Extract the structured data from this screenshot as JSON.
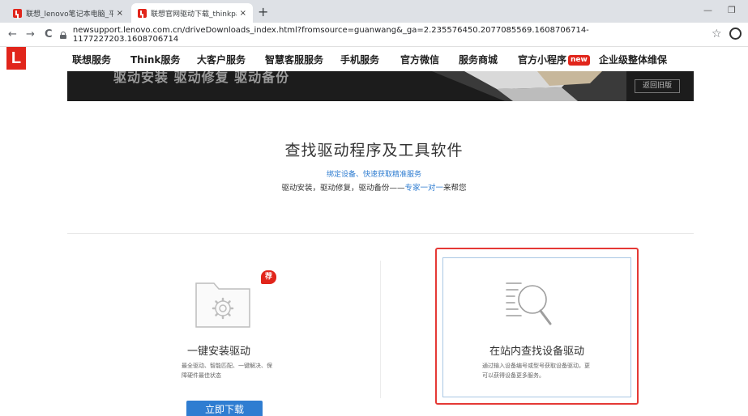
{
  "browser": {
    "tabs": [
      {
        "title": "联想_lenovo笔记本电脑_平板电脑",
        "close": "×"
      },
      {
        "title": "联想官网驱动下载_thinkpad驱动",
        "close": "×"
      }
    ],
    "new_tab": "+",
    "window_minimize": "—",
    "window_restore": "❐",
    "nav": {
      "back": "←",
      "forward": "→",
      "reload": "C"
    },
    "url": "newsupport.lenovo.com.cn/driveDownloads_index.html?fromsource=guanwang&_ga=2.235576450.2077085569.1608706714-1177227203.1608706714",
    "star": "☆"
  },
  "site": {
    "logo": "L",
    "nav_items": [
      {
        "label": "联想服务"
      },
      {
        "label": "Think服务"
      },
      {
        "label": "大客户服务"
      },
      {
        "label": "智慧客服服务"
      },
      {
        "label": "手机服务"
      },
      {
        "label": "官方微信"
      },
      {
        "label": "服务商城"
      },
      {
        "label": "官方小程序"
      },
      {
        "label": "企业级整体维保"
      }
    ],
    "new_badge": "new"
  },
  "banner": {
    "text": "驱动安装  驱动修复  驱动备份",
    "button": "返回旧版"
  },
  "hero": {
    "title": "查找驱动程序及工具软件",
    "subtitle_link": "绑定设备、快速获取精准服务",
    "subtitle_prefix": "驱动安装，驱动修复，驱动备份——",
    "subtitle_highlight": "专家一对一",
    "subtitle_suffix": "来帮您"
  },
  "left_card": {
    "badge": "荐",
    "title": "一键安装驱动",
    "description": "最全驱动、智能匹配、一键解决、保障硬件最佳状态",
    "button": "立即下载"
  },
  "right_card": {
    "title": "在站内查找设备驱动",
    "description": "通过输入设备编号或型号获取设备驱动，更可以获得设备更多服务。"
  },
  "colors": {
    "brand_red": "#e1251b",
    "link_blue": "#2f7dd1",
    "highlight_red": "#e53935"
  }
}
